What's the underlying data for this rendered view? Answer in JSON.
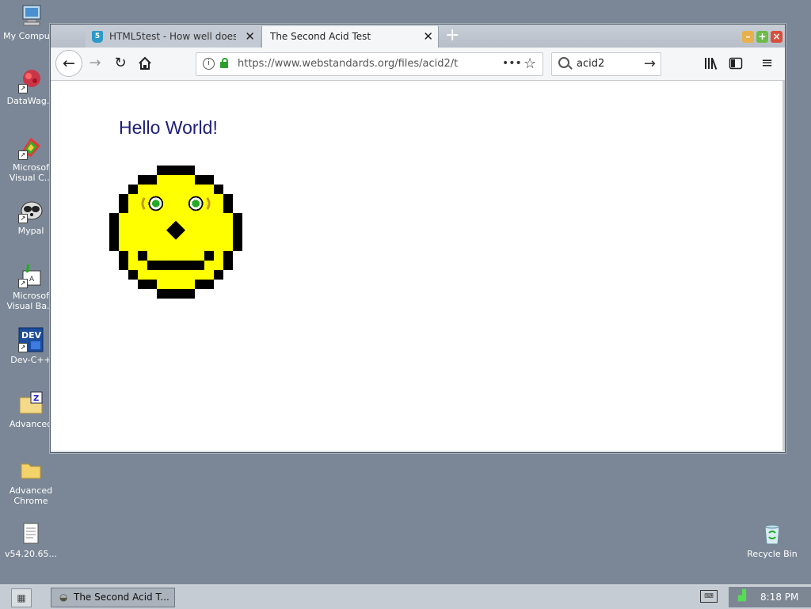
{
  "desktop": {
    "icons": [
      {
        "label": "My Compute",
        "icon": "computer-icon"
      },
      {
        "label": "DataWag...",
        "icon": "datawag-icon"
      },
      {
        "label": "Microsof",
        "label2": "Visual C...",
        "icon": "visual-cpp-icon"
      },
      {
        "label": "Mypal",
        "icon": "mypal-icon"
      },
      {
        "label": "Microsof",
        "label2": "Visual Ba...",
        "icon": "visual-basic-icon"
      },
      {
        "label": "Dev-C++",
        "icon": "devcpp-icon"
      },
      {
        "label": "Advanced",
        "icon": "archive-icon"
      },
      {
        "label": "Advanced",
        "label2": "Chrome",
        "icon": "folder-icon"
      },
      {
        "label": "v54.20.65...",
        "icon": "document-icon"
      },
      {
        "label": "Recycle Bin",
        "icon": "recycle-bin-icon"
      }
    ]
  },
  "browser": {
    "tabs": [
      {
        "label": "HTML5test - How well does y",
        "icon": "html5-icon",
        "active": false
      },
      {
        "label": "The Second Acid Test",
        "active": true
      }
    ],
    "new_tab": "+",
    "url": "https://www.webstandards.org/files/acid2/t",
    "search_value": "acid2",
    "page": {
      "heading": "Hello World!"
    },
    "colors": {
      "face_fill": "#ffff00",
      "face_outline": "#000000",
      "eye": "#22aa22",
      "heading": "#1e1e7a"
    }
  },
  "taskbar": {
    "task_label": "The Second Acid T...",
    "clock": "8:18 PM"
  }
}
